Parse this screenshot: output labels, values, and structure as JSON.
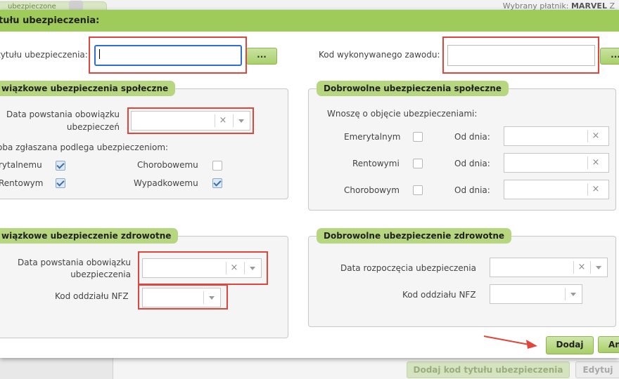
{
  "background": {
    "tab_label": "ubezpieczone",
    "payer_label": "Wybrany płatnik:",
    "payer_value": "MARVEL",
    "payer_suffix": "Z",
    "add_code_button": "Dodaj kod tytułu ubezpieczenia",
    "edit_button": "Edytuj"
  },
  "dialog": {
    "title": "tułu ubezpieczenia:",
    "title_code_label": "tytułu ubezpieczenia:",
    "title_code_value": "",
    "dots_button": "...",
    "occupation_label": "Kod wykonywanego zawodu:",
    "occupation_value": "",
    "mandatory_social": {
      "header": "wiązkowe ubezpieczenia społeczne",
      "date_label_line1": "Data powstania obowiązku",
      "date_label_line2": "ubezpieczeń",
      "subject_label": "oba zgłaszana podlega ubezpieczeniom:",
      "checkboxes": [
        {
          "label": "rytalnemu",
          "checked": true
        },
        {
          "label": "Rentowym",
          "checked": true
        },
        {
          "label": "Chorobowemu",
          "checked": false
        },
        {
          "label": "Wypadkowemu",
          "checked": true
        }
      ]
    },
    "voluntary_social": {
      "header": "Dobrowolne ubezpieczenia społeczne",
      "intro": "Wnoszę o objęcie ubezpieczeniami:",
      "rows": [
        {
          "label": "Emerytalnym",
          "from_label": "Od dnia:",
          "checked": false
        },
        {
          "label": "Rentowymi",
          "from_label": "Od dnia:",
          "checked": false
        },
        {
          "label": "Chorobowym",
          "from_label": "Od dnia:",
          "checked": false
        }
      ]
    },
    "mandatory_health": {
      "header": "wiązkowe ubezpieczenie zdrowotne",
      "date_label_line1": "Data powstania obowiązku",
      "date_label_line2": "ubezpieczenia",
      "nfz_label": "Kod oddziału NFZ"
    },
    "voluntary_health": {
      "header": "Dobrowolne ubezpieczenie zdrowotne",
      "start_label": "Data rozpoczęcia ubezpieczenia",
      "nfz_label": "Kod oddziału NFZ"
    },
    "add_button": "Dodaj",
    "cancel_button": "An"
  },
  "icons": {
    "clear": "×",
    "dropdown": "chevron-down-icon"
  },
  "colors": {
    "titlebar": "#9ecb5a",
    "section_header": "#b6d77f",
    "highlight": "#e0463c",
    "focus": "#2b6fd6"
  }
}
